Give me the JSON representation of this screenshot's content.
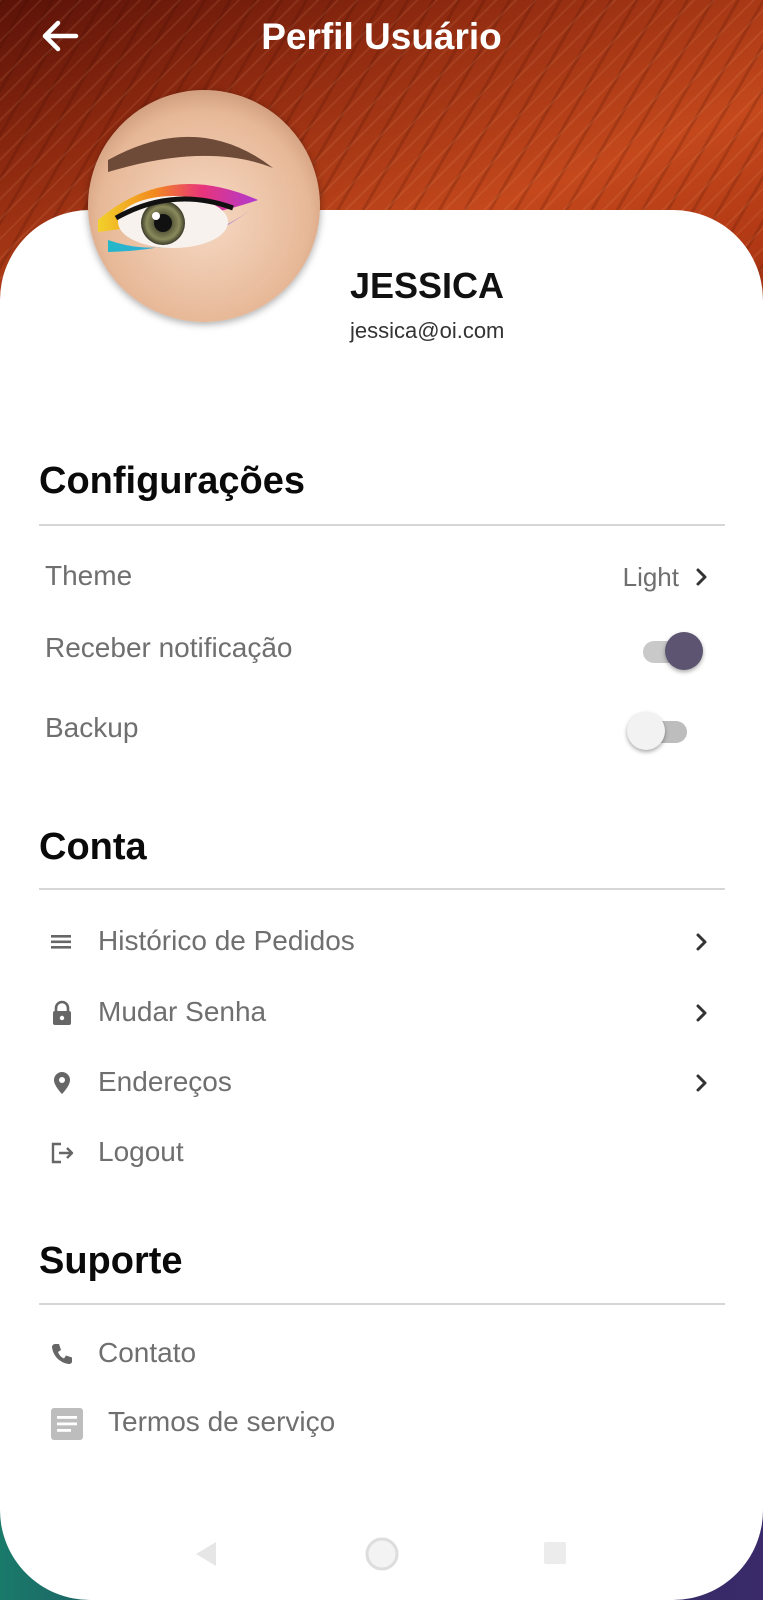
{
  "header": {
    "title": "Perfil Usuário",
    "back_icon": "arrow-left-icon"
  },
  "profile": {
    "name": "JESSICA",
    "email": "jessica@oi.com",
    "avatar": "avatar-eye-makeup-image"
  },
  "sections": {
    "settings": {
      "title": "Configurações",
      "theme": {
        "label": "Theme",
        "value": "Light",
        "icon": "chevron-right-icon"
      },
      "notifications": {
        "label": "Receber notificação",
        "enabled": true
      },
      "backup": {
        "label": "Backup",
        "enabled": false
      }
    },
    "account": {
      "title": "Conta",
      "items": [
        {
          "label": "Histórico de Pedidos",
          "icon": "list-icon",
          "has_chevron": true
        },
        {
          "label": "Mudar Senha",
          "icon": "lock-icon",
          "has_chevron": true
        },
        {
          "label": "Endereços",
          "icon": "location-pin-icon",
          "has_chevron": true
        },
        {
          "label": "Logout",
          "icon": "logout-icon",
          "has_chevron": false
        }
      ]
    },
    "support": {
      "title": "Suporte",
      "items": [
        {
          "label": "Contato",
          "icon": "phone-icon"
        },
        {
          "label": "Termos de serviço",
          "icon": "document-icon"
        }
      ]
    }
  },
  "colors": {
    "toggle_on_thumb": "#5c5470",
    "toggle_on_track": "#c9c9c9",
    "toggle_off_thumb": "#f2f2f2",
    "toggle_off_track": "#bdbdbd",
    "label_text": "#6f6f6f",
    "icon_gray": "#666666"
  },
  "system_nav": {
    "back": "nav-back-icon",
    "home": "nav-home-icon",
    "recents": "nav-recents-icon"
  }
}
